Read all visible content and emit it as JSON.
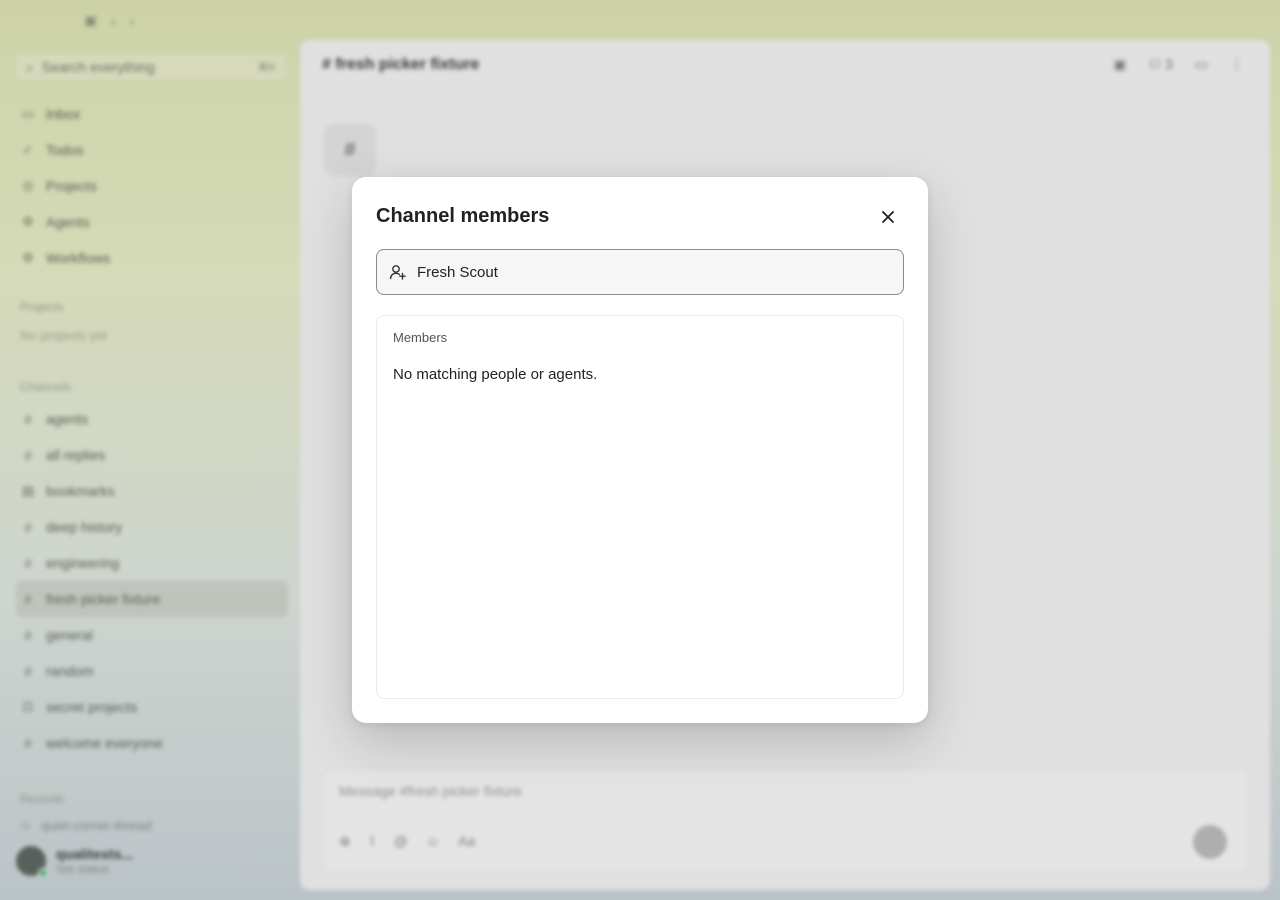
{
  "sidebar": {
    "search_placeholder": "Search everything",
    "search_shortcut": "⌘K",
    "nav_items": [
      {
        "label": "Inbox",
        "icon": "inbox-icon"
      },
      {
        "label": "Todos",
        "icon": "todo-icon"
      },
      {
        "label": "Projects",
        "icon": "projects-icon"
      },
      {
        "label": "Agents",
        "icon": "agents-icon"
      },
      {
        "label": "Workflows",
        "icon": "workflows-icon"
      }
    ],
    "projects_label": "Projects",
    "projects_empty": "No projects yet",
    "channels_label": "Channels",
    "channels": [
      {
        "label": "agents"
      },
      {
        "label": "all replies"
      },
      {
        "label": "bookmarks"
      },
      {
        "label": "deep history"
      },
      {
        "label": "engineering"
      },
      {
        "label": "fresh picker fixture",
        "active": true
      },
      {
        "label": "general"
      },
      {
        "label": "random"
      },
      {
        "label": "secret projects"
      },
      {
        "label": "welcome everyone"
      }
    ],
    "recents_label": "Recents",
    "recent_item": "quiet-corner-thread",
    "user": {
      "name": "qualitests...",
      "status": "Set status"
    }
  },
  "main": {
    "channel_title": "fresh picker fixture",
    "member_count": "3",
    "composer_placeholder": "Message #fresh picker fixture"
  },
  "dialog": {
    "title": "Channel members",
    "search_value": "Fresh Scout",
    "members_label": "Members",
    "empty_message": "No matching people or agents."
  }
}
